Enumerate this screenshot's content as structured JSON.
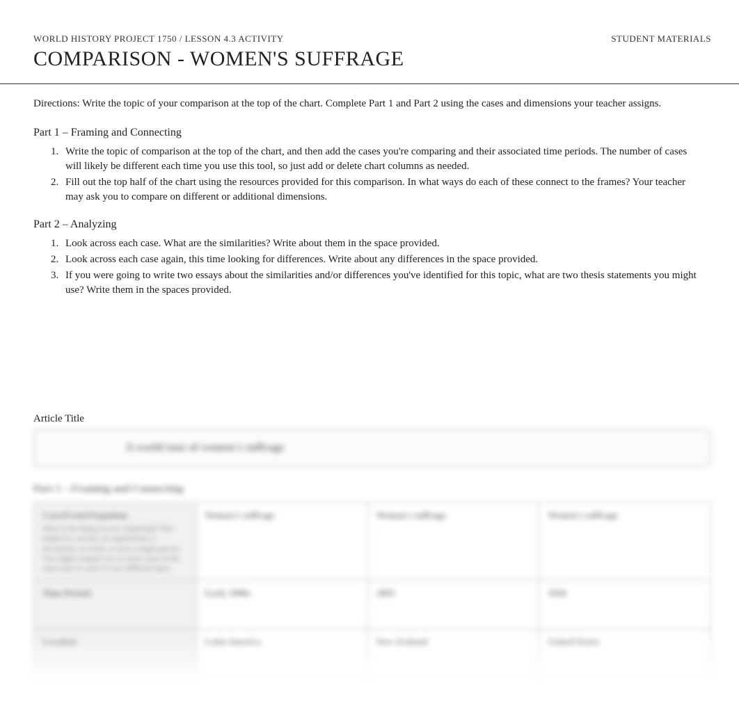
{
  "header": {
    "course_label": "WORLD HISTORY PROJECT 1750 / LESSON 4.3 ACTIVITY",
    "student_materials": "STUDENT MATERIALS",
    "main_title": "COMPARISON - WOMEN'S SUFFRAGE"
  },
  "directions": "Directions:  Write the topic of your comparison at the top of the chart. Complete Part 1 and Part 2 using the cases and dimensions your teacher assigns.",
  "part1": {
    "heading": "Part 1 – Framing and Connecting",
    "items": [
      "Write the topic of comparison at the top of the chart, and then add the cases you're comparing and their associated time periods. The number of cases will likely be different each time you use this tool, so just add or delete chart columns as needed.",
      "Fill out the top half of the chart using the resources provided for this comparison. In what ways do each of these connect to the frames? Your teacher may ask you to compare on different or additional dimensions."
    ]
  },
  "part2": {
    "heading": "Part 2 – Analyzing",
    "items": [
      "Look across each case. What are the similarities? Write about them in the space provided.",
      "Look across each case again, this time looking for differences. Write about any differences in the space provided.",
      "If you were going to write two essays about the similarities and/or differences you've identified for this topic, what are two thesis statements you might use? Write them in the spaces provided."
    ]
  },
  "article_title_label": "Article Title",
  "blurred": {
    "title_box": "A world tour of women's suffrage",
    "section_heading": "Part 1 – Framing and Connecting",
    "rows": [
      {
        "label": "Case/Event/Organism",
        "sub": "What is the thing you are comparing? This might be a society, an organization, a movement, an event, or even a single person. You might compare two or more cases of the same type or cases of very different types.",
        "cells": [
          "Women's suffrage",
          "Women's suffrage",
          "Women's suffrage"
        ]
      },
      {
        "label": "Time Period",
        "sub": "",
        "cells": [
          "Early 1900s",
          "1893",
          "1920"
        ]
      },
      {
        "label": "Location",
        "sub": "",
        "cells": [
          "Latin America",
          "New Zealand",
          "United States"
        ]
      }
    ]
  }
}
